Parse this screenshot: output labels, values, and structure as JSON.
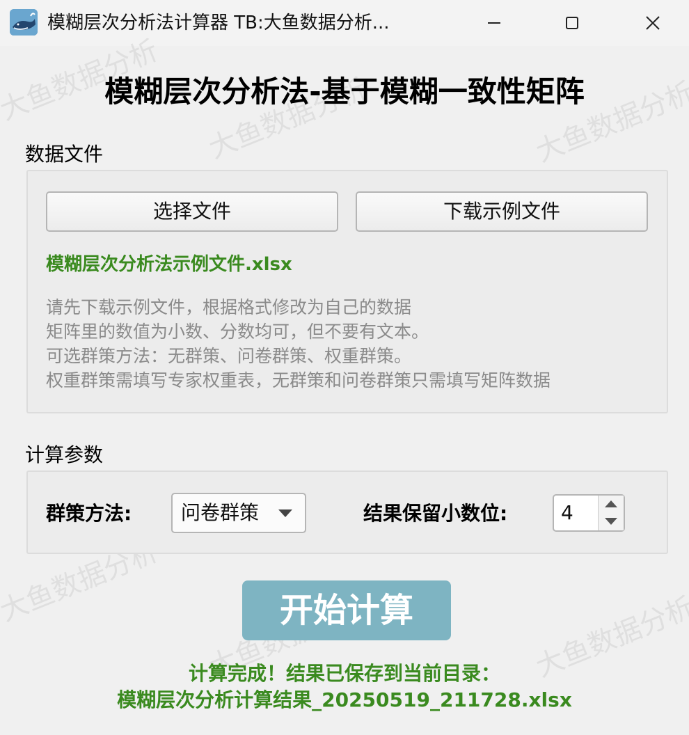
{
  "window": {
    "title": "模糊层次分析法计算器  TB:大鱼数据分析...",
    "app_icon": "whale-app-icon"
  },
  "watermark": {
    "text": "大鱼数据分析"
  },
  "header": {
    "title": "模糊层次分析法-基于模糊一致性矩阵"
  },
  "data_file": {
    "section_label": "数据文件",
    "select_button_label": "选择文件",
    "download_button_label": "下载示例文件",
    "selected_file": "模糊层次分析法示例文件.xlsx",
    "hints": [
      "请先下载示例文件，根据格式修改为自己的数据",
      "矩阵里的数值为小数、分数均可，但不要有文本。",
      "可选群策方法：无群策、问卷群策、权重群策。",
      "权重群策需填写专家权重表，无群策和问卷群策只需填写矩阵数据"
    ]
  },
  "params": {
    "section_label": "计算参数",
    "method_label": "群策方法:",
    "method_value": "问卷群策",
    "decimals_label": "结果保留小数位:",
    "decimals_value": "4"
  },
  "actions": {
    "start_label": "开始计算"
  },
  "status": {
    "line1": "计算完成！结果已保存到当前目录：",
    "line2": "模糊层次分析计算结果_20250519_211728.xlsx"
  },
  "colors": {
    "accent_green": "#3a8a1f",
    "start_button": "#7eb4c2",
    "hint_gray": "#8a8a8a"
  }
}
